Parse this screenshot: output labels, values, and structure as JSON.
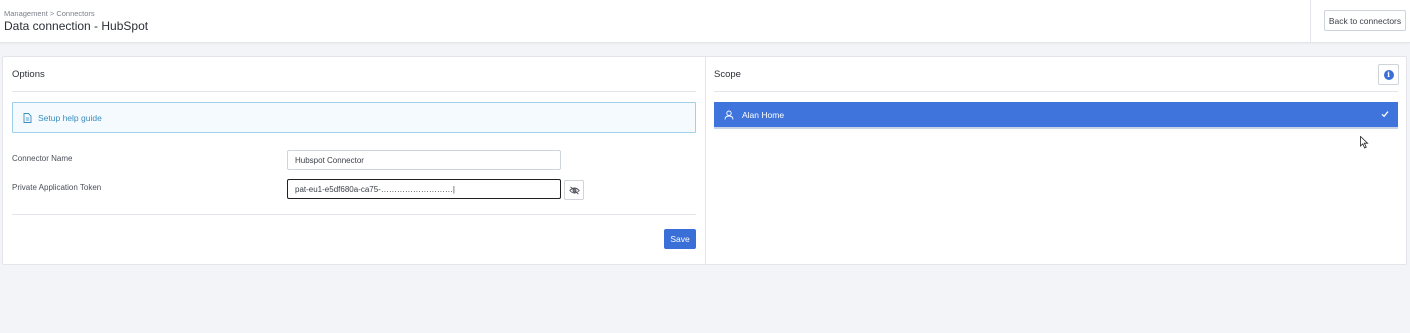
{
  "header": {
    "breadcrumb": "Management > Connectors",
    "title": "Data connection - HubSpot",
    "back_label": "Back to connectors"
  },
  "options": {
    "title": "Options",
    "help_link": "Setup help guide",
    "connector_name_label": "Connector Name",
    "connector_name_value": "Hubspot Connector",
    "token_label": "Private Application Token",
    "token_value": "pat-eu1-e5df680a-ca75-………………………|",
    "save_label": "Save"
  },
  "scope": {
    "title": "Scope",
    "items": [
      {
        "label": "Alan Home",
        "selected": true
      }
    ]
  },
  "colors": {
    "primary": "#3a6fd8",
    "scope_selected": "#3f74dc",
    "help_border": "#9fd1ea",
    "help_text": "#3a8dc0"
  },
  "icons": [
    "document-icon",
    "eye-off-icon",
    "info-icon",
    "user-icon",
    "check-icon",
    "mouse-cursor-icon"
  ]
}
